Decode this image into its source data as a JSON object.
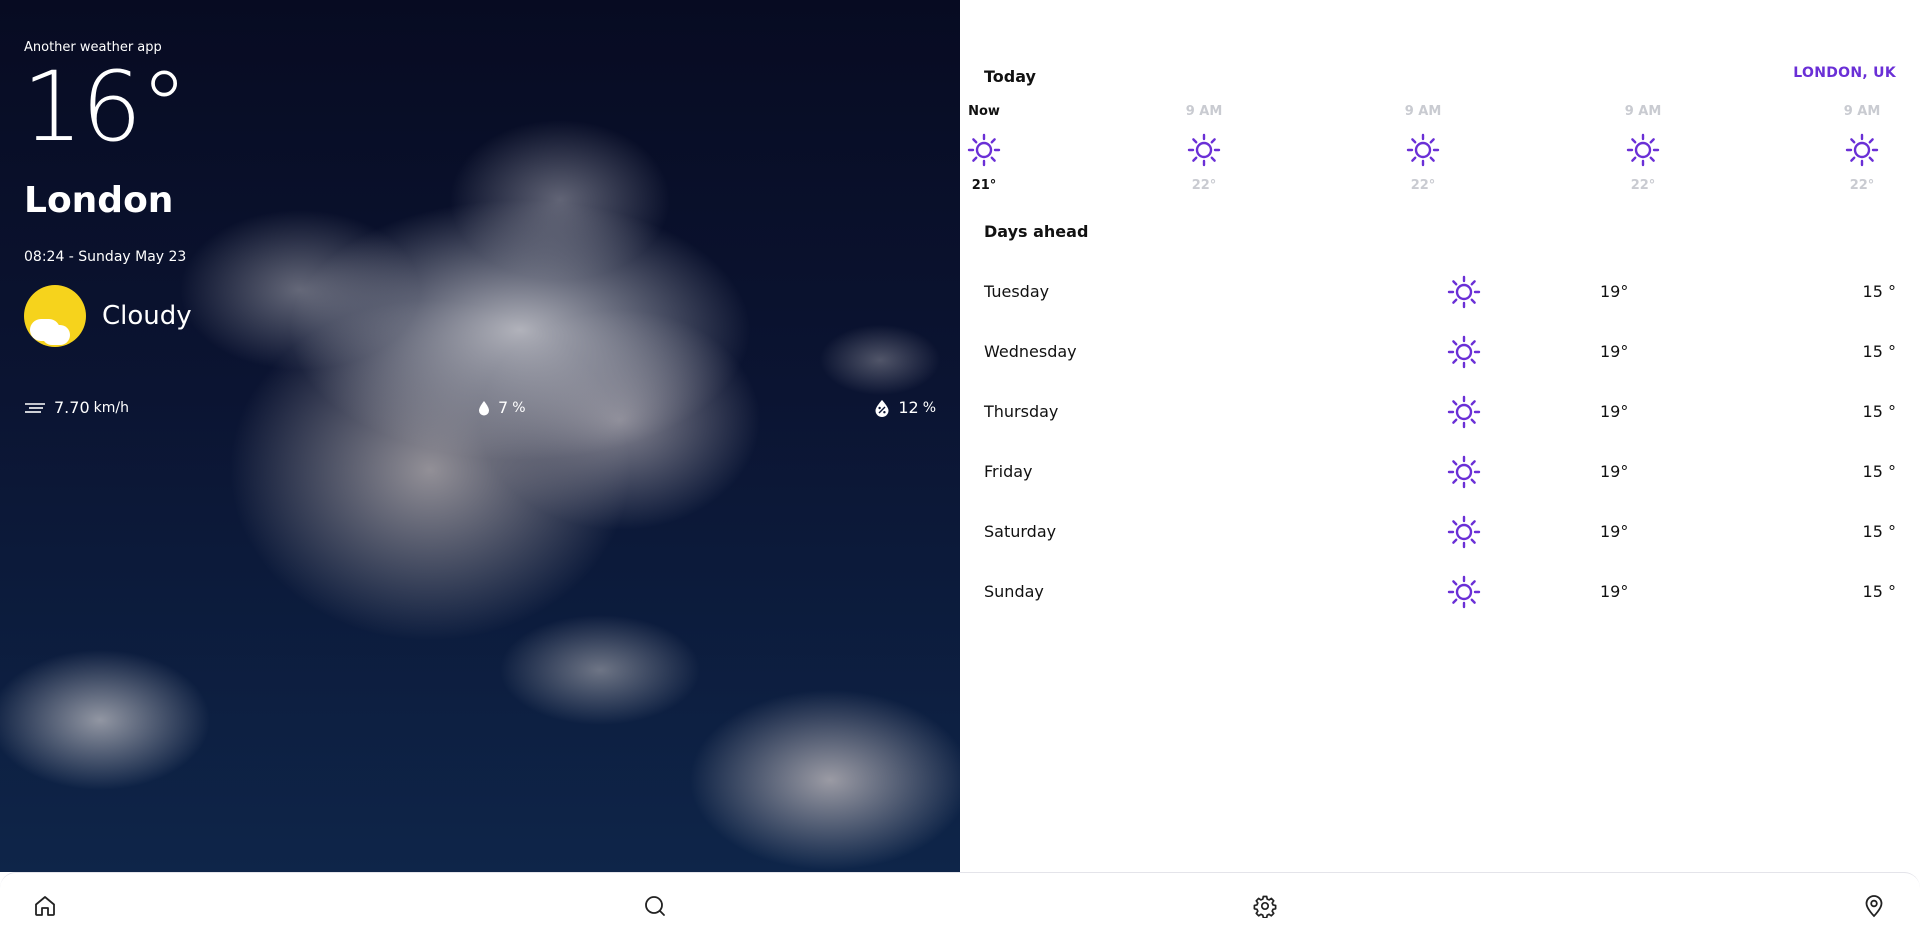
{
  "app": {
    "name": "Another weather app"
  },
  "current": {
    "temperature": "16°",
    "city": "London",
    "datetime": "08:24 - Sunday May 23",
    "condition": "Cloudy",
    "condition_icon": "sun-cloud-icon"
  },
  "stats": {
    "wind": {
      "value": "7.70",
      "unit": "km/h",
      "icon": "wind-icon"
    },
    "humidity": {
      "value": "7",
      "unit": "%",
      "icon": "droplet-icon"
    },
    "precipitation": {
      "value": "12",
      "unit": "%",
      "icon": "rain-chance-icon"
    }
  },
  "today": {
    "heading": "Today",
    "location": "LONDON, UK",
    "hours": [
      {
        "label": "Now",
        "temp": "21°",
        "icon": "sun-icon"
      },
      {
        "label": "9 AM",
        "temp": "22°",
        "icon": "sun-icon"
      },
      {
        "label": "9 AM",
        "temp": "22°",
        "icon": "sun-icon"
      },
      {
        "label": "9 AM",
        "temp": "22°",
        "icon": "sun-icon"
      },
      {
        "label": "9 AM",
        "temp": "22°",
        "icon": "sun-icon"
      }
    ]
  },
  "days_ahead": {
    "heading": "Days ahead",
    "days": [
      {
        "name": "Tuesday",
        "high": "19°",
        "low": "15 °",
        "icon": "sun-icon"
      },
      {
        "name": "Wednesday",
        "high": "19°",
        "low": "15 °",
        "icon": "sun-icon"
      },
      {
        "name": "Thursday",
        "high": "19°",
        "low": "15 °",
        "icon": "sun-icon"
      },
      {
        "name": "Friday",
        "high": "19°",
        "low": "15 °",
        "icon": "sun-icon"
      },
      {
        "name": "Saturday",
        "high": "19°",
        "low": "15 °",
        "icon": "sun-icon"
      },
      {
        "name": "Sunday",
        "high": "19°",
        "low": "15 °",
        "icon": "sun-icon"
      }
    ]
  },
  "nav": {
    "items": [
      {
        "icon": "home-icon"
      },
      {
        "icon": "search-icon"
      },
      {
        "icon": "gear-icon"
      },
      {
        "icon": "location-pin-icon"
      }
    ]
  },
  "colors": {
    "accent": "#6a2fd6",
    "sun": "#f6d31c",
    "muted": "#c9cbd1"
  }
}
